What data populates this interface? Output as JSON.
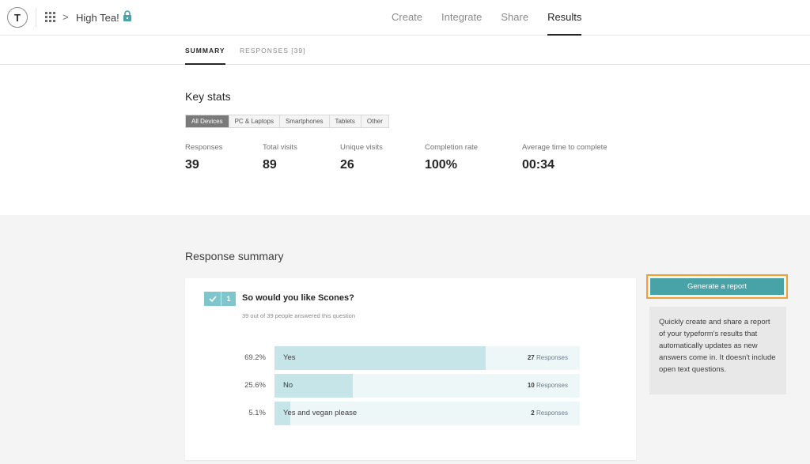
{
  "header": {
    "avatar_letter": "T",
    "form_title": "High Tea!",
    "nav": [
      "Create",
      "Integrate",
      "Share",
      "Results"
    ],
    "active_nav": "Results",
    "icons": [
      "apps-grid-icon",
      "chevron-right-icon",
      "lock-icon"
    ]
  },
  "subtabs": {
    "summary": "SUMMARY",
    "responses": "RESPONSES [39]"
  },
  "key_stats": {
    "title": "Key stats",
    "filters": [
      "All Devices",
      "PC & Laptops",
      "Smartphones",
      "Tablets",
      "Other"
    ],
    "active_filter": "All Devices",
    "stats": [
      {
        "label": "Responses",
        "value": "39"
      },
      {
        "label": "Total visits",
        "value": "89"
      },
      {
        "label": "Unique visits",
        "value": "26"
      },
      {
        "label": "Completion rate",
        "value": "100%"
      },
      {
        "label": "Average time to complete",
        "value": "00:34"
      }
    ]
  },
  "response_summary": {
    "title": "Response summary",
    "question": {
      "number": "1",
      "title": "So would you like Scones?",
      "subtitle": "39 out of 39 people answered this question",
      "answers": [
        {
          "percent": "69.2%",
          "fraction": 0.692,
          "label": "Yes",
          "count": "27",
          "count_label": "Responses"
        },
        {
          "percent": "25.6%",
          "fraction": 0.256,
          "label": "No",
          "count": "10",
          "count_label": "Responses"
        },
        {
          "percent": "5.1%",
          "fraction": 0.051,
          "label": "Yes and vegan please",
          "count": "2",
          "count_label": "Responses"
        }
      ]
    }
  },
  "report": {
    "button_label": "Generate a report",
    "info_text": "Quickly create and share a report of your typeform's results that automatically updates as new answers come in. It doesn't include open text questions."
  },
  "colors": {
    "accent_teal": "#47a3a6",
    "highlight_orange": "#f0a032",
    "bar_fill": "#c5e5e8",
    "bar_track": "#eef7f8"
  }
}
